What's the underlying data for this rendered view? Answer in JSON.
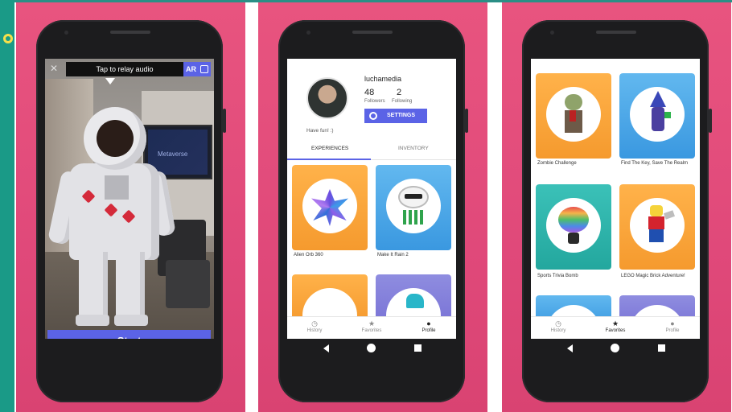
{
  "screen1": {
    "relay_text": "Tap to relay audio",
    "ar_label": "AR",
    "tv_text": "Metaverse",
    "start_label": "Start"
  },
  "screen2": {
    "username": "luchamedia",
    "followers_count": "48",
    "followers_label": "Followers",
    "following_count": "2",
    "following_label": "Following",
    "settings_label": "SETTINGS",
    "bio": "Have fun! :)",
    "tabs": [
      "EXPERIENCES",
      "INVENTORY"
    ],
    "cards": [
      "Alien Orb 360",
      "Make It Rain 2"
    ],
    "nav": [
      {
        "label": "History",
        "icon": "history-icon"
      },
      {
        "label": "Favorites",
        "icon": "star-icon"
      },
      {
        "label": "Profile",
        "icon": "person-icon"
      }
    ],
    "active_nav": "Profile"
  },
  "screen3": {
    "cards": [
      "Zombie Challenge",
      "Find The Key, Save The Realm",
      "Sports Trivia Bomb",
      "LEGO Magic Brick Adventure!"
    ],
    "nav": [
      {
        "label": "History",
        "icon": "history-icon"
      },
      {
        "label": "Favorites",
        "icon": "star-icon"
      },
      {
        "label": "Profile",
        "icon": "person-icon"
      }
    ],
    "active_nav": "Favorites"
  },
  "colors": {
    "accent": "#5b63e6",
    "background_pink": "#e2497a",
    "teal_strip": "#1a9a87"
  }
}
